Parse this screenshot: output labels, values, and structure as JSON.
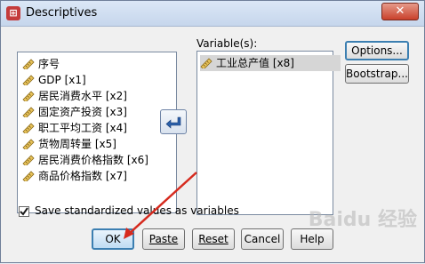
{
  "window": {
    "title": "Descriptives",
    "app_icon": "spss-app-icon",
    "close_label": "✕"
  },
  "variables_label": "Variable(s):",
  "source_list": [
    {
      "label": "序号"
    },
    {
      "label": "GDP [x1]"
    },
    {
      "label": "居民消费水平 [x2]"
    },
    {
      "label": "固定资产投资 [x3]"
    },
    {
      "label": "职工平均工资 [x4]"
    },
    {
      "label": "货物周转量 [x5]"
    },
    {
      "label": "居民消费价格指数 [x6]"
    },
    {
      "label": "商品价格指数 [x7]"
    }
  ],
  "selected_list": [
    {
      "label": "工业总产值 [x8]"
    }
  ],
  "side_buttons": {
    "options": "Options...",
    "bootstrap": "Bootstrap..."
  },
  "checkbox": {
    "label": "Save standardized values as variables",
    "checked": true
  },
  "buttons": {
    "ok": "OK",
    "paste": "Paste",
    "reset": "Reset",
    "cancel": "Cancel",
    "help": "Help"
  },
  "watermark": "Baidu 经验",
  "colors": {
    "annotation_arrow": "#d62a1e",
    "accent": "#3c7fb1",
    "ruler_icon": "#c8a23a"
  }
}
